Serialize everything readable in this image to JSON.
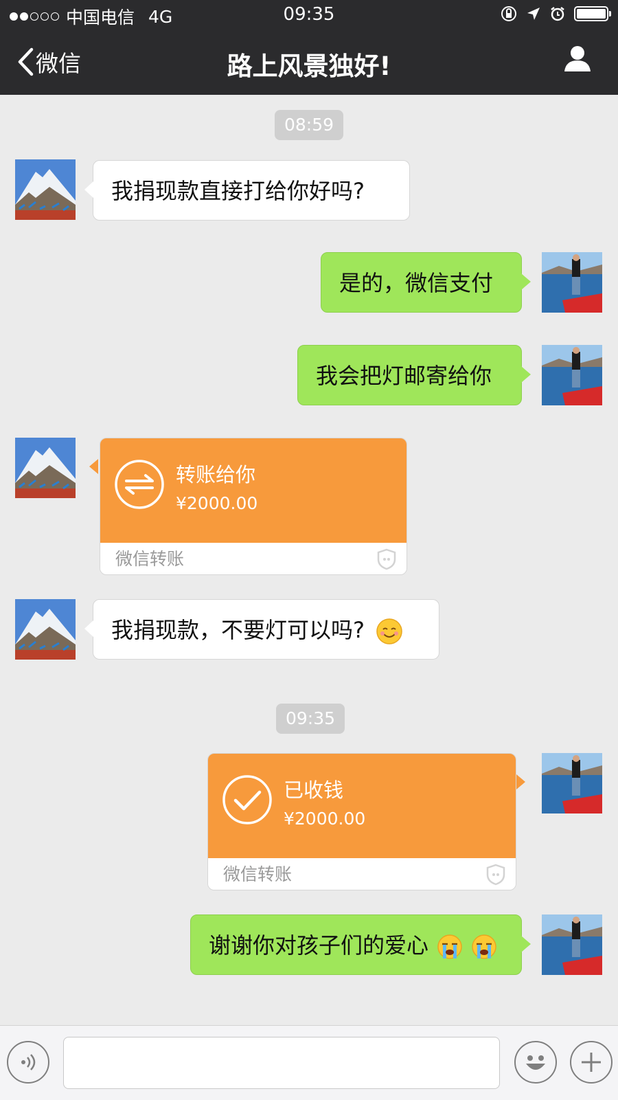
{
  "status": {
    "carrier": "中国电信",
    "network": "4G",
    "time": "09:35"
  },
  "nav": {
    "back_label": "微信",
    "title": "路上风景独好!"
  },
  "timestamps": [
    "08:59",
    "09:35"
  ],
  "messages": {
    "m1": "我捐现款直接打给你好吗?",
    "m2": "是的，微信支付",
    "m3": "我会把灯邮寄给你",
    "m4": "我捐现款，不要灯可以吗?",
    "m5": "谢谢你对孩子们的爱心"
  },
  "transfer1": {
    "title": "转账给你",
    "amount": "¥2000.00",
    "footer": "微信转账"
  },
  "transfer2": {
    "title": "已收钱",
    "amount": "¥2000.00",
    "footer": "微信转账"
  },
  "icons": [
    "signal-dots-icon",
    "orientation-lock-icon",
    "location-icon",
    "alarm-icon",
    "battery-icon",
    "back-chevron-icon",
    "profile-icon",
    "transfer-arrows-icon",
    "checkmark-icon",
    "shield-icon",
    "smile-emoji-icon",
    "crying-emoji-icon",
    "voice-icon",
    "sticker-icon",
    "plus-icon"
  ],
  "colors": {
    "bar": "#2b2b2d",
    "bg": "#ebebeb",
    "bubble_out": "#9fe65a",
    "transfer": "#f79a3c"
  }
}
